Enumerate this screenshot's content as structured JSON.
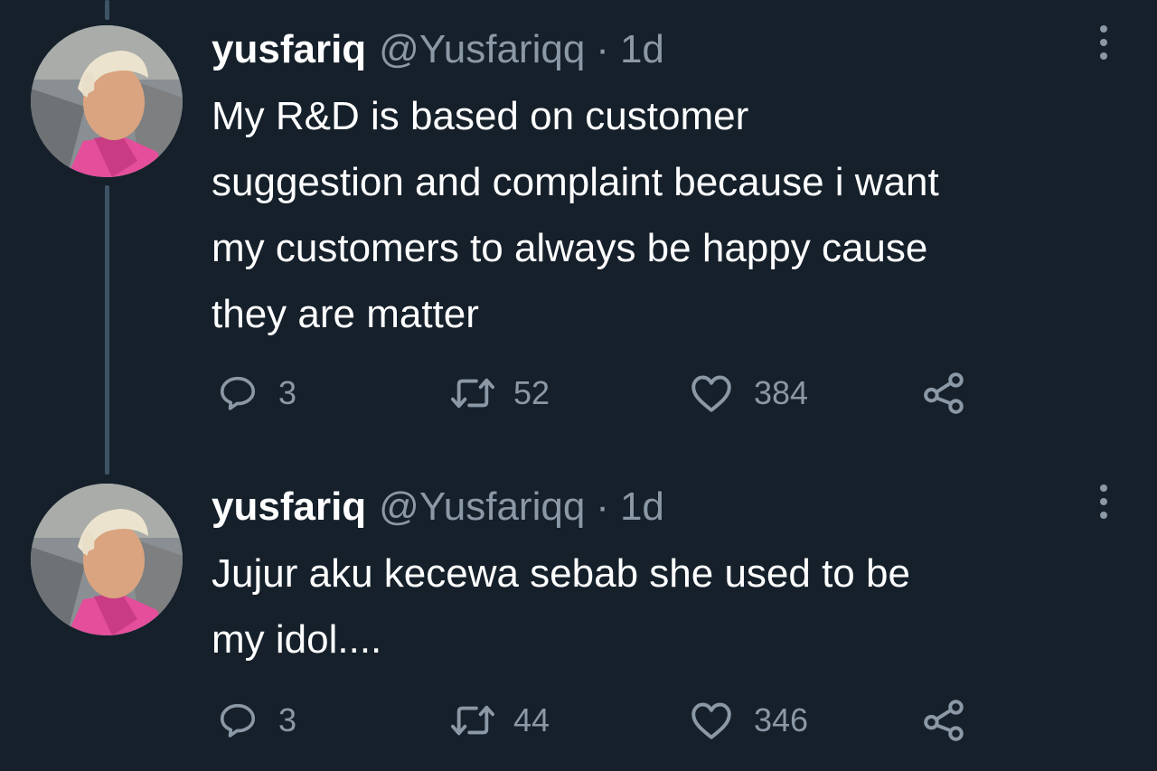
{
  "colors": {
    "background": "#15202b",
    "text_primary": "#ffffff",
    "text_secondary": "#8b98a5",
    "thread_line": "#3d5466"
  },
  "tweets": [
    {
      "display_name": "yusfariq",
      "handle": "@Yusfariqq",
      "separator": "·",
      "time": "1d",
      "text": "My R&D is based on customer\nsuggestion and complaint because i want\nmy customers to always be happy cause\nthey are matter",
      "replies": "3",
      "retweets": "52",
      "likes": "384",
      "icons": [
        "reply-icon",
        "retweet-icon",
        "heart-icon",
        "share-icon",
        "more-icon"
      ]
    },
    {
      "display_name": "yusfariq",
      "handle": "@Yusfariqq",
      "separator": "·",
      "time": "1d",
      "text": "Jujur aku kecewa sebab she used to be\nmy idol....",
      "replies": "3",
      "retweets": "44",
      "likes": "346",
      "icons": [
        "reply-icon",
        "retweet-icon",
        "heart-icon",
        "share-icon",
        "more-icon"
      ]
    }
  ]
}
